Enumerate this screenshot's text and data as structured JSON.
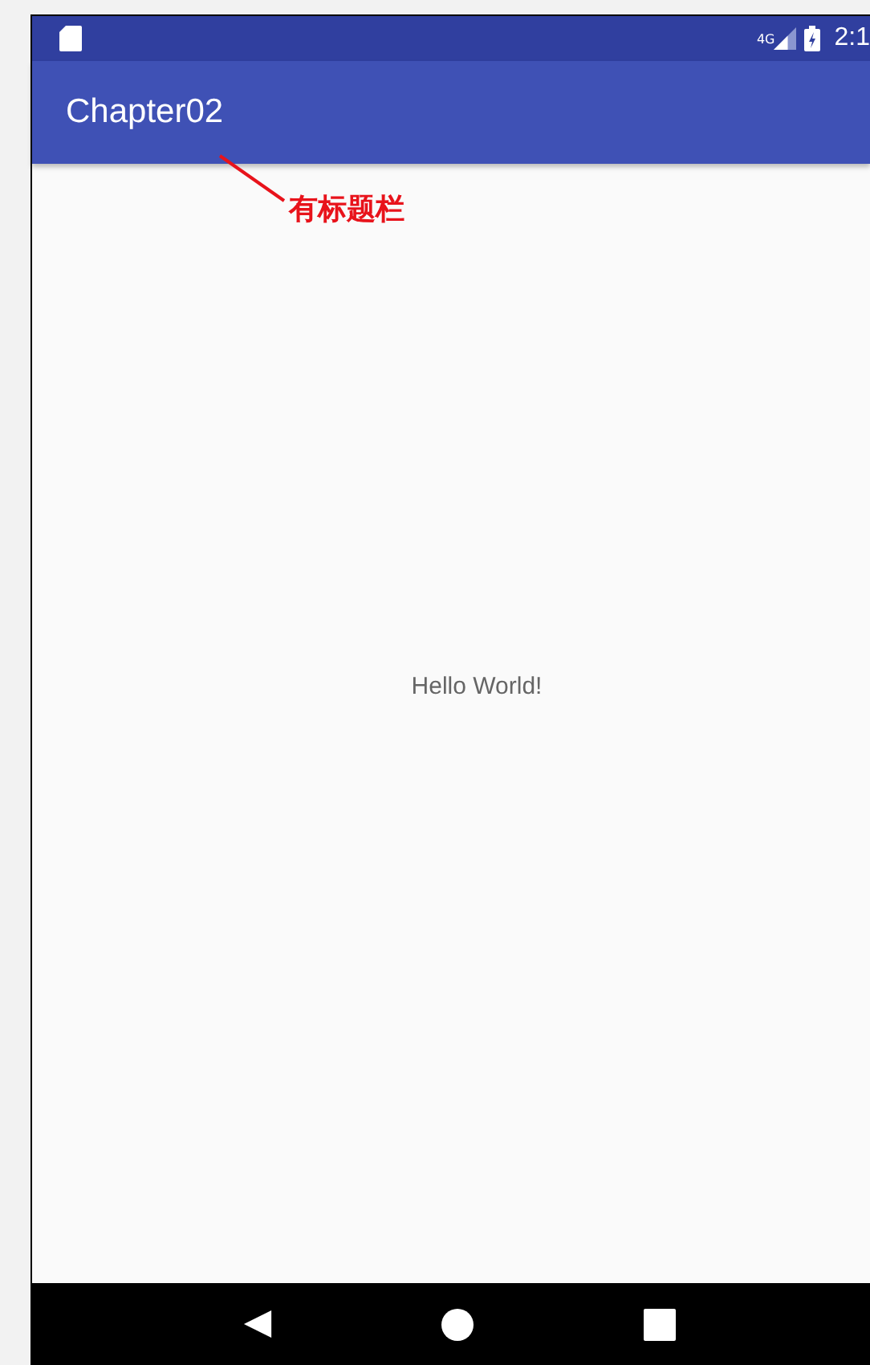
{
  "status_bar": {
    "network": "4G",
    "time": "2:1"
  },
  "app_bar": {
    "title": "Chapter02"
  },
  "annotation": {
    "text": "有标题栏"
  },
  "content": {
    "text": "Hello World!"
  }
}
